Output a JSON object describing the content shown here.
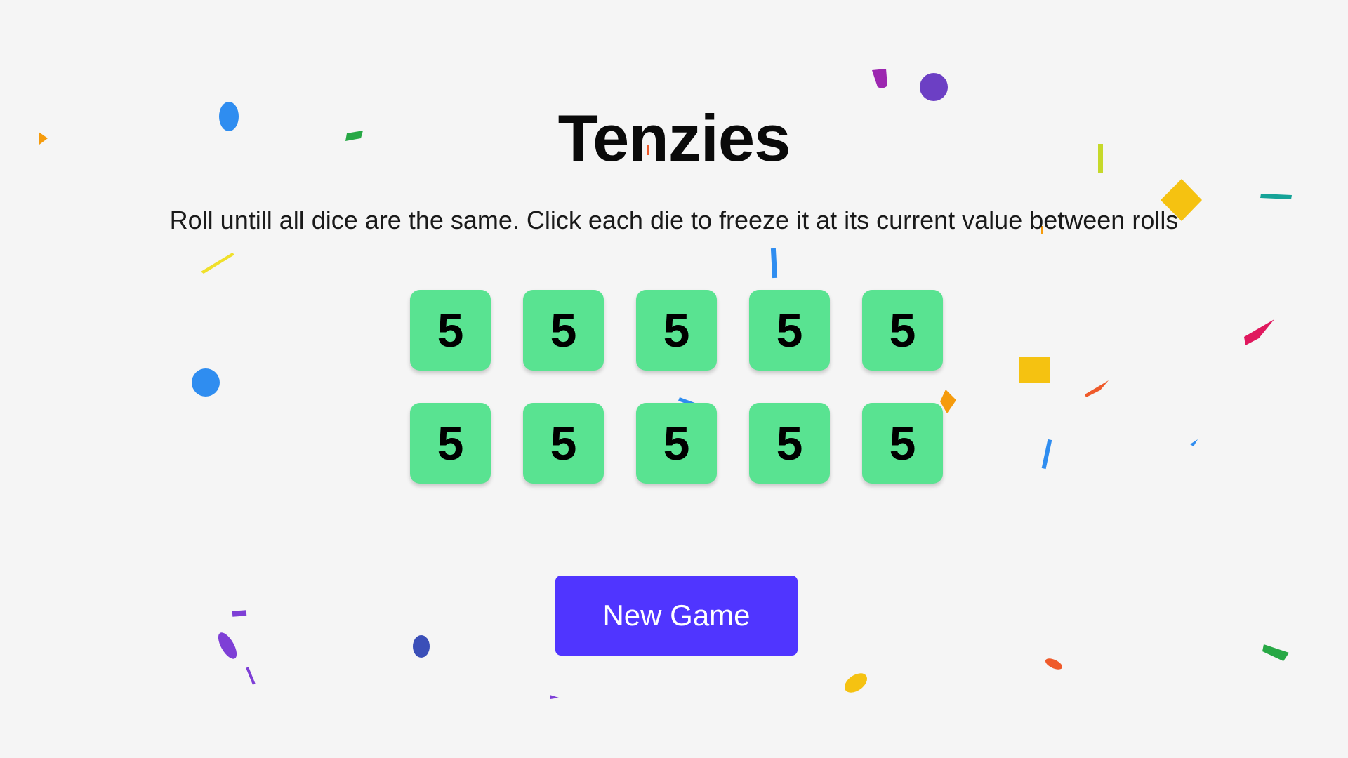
{
  "game": {
    "title": "Tenzies",
    "instructions": "Roll untill all dice are the same. Click each die to freeze it at its current value between rolls",
    "dice": [
      {
        "value": "5",
        "held": true
      },
      {
        "value": "5",
        "held": true
      },
      {
        "value": "5",
        "held": true
      },
      {
        "value": "5",
        "held": true
      },
      {
        "value": "5",
        "held": true
      },
      {
        "value": "5",
        "held": true
      },
      {
        "value": "5",
        "held": true
      },
      {
        "value": "5",
        "held": true
      },
      {
        "value": "5",
        "held": true
      },
      {
        "value": "5",
        "held": true
      }
    ],
    "new_game_label": "New Game",
    "status": "won"
  },
  "colors": {
    "background": "#f5f5f5",
    "die_held": "#59e391",
    "button": "#5035ff",
    "button_text": "#ffffff",
    "confetti": [
      "#2f8df0",
      "#7e3fd6",
      "#f0c20f",
      "#e0185e",
      "#ef5a2a",
      "#27a845",
      "#15a398",
      "#c6d92a",
      "#f59b0c",
      "#3b4fb8",
      "#9c27b0"
    ]
  }
}
